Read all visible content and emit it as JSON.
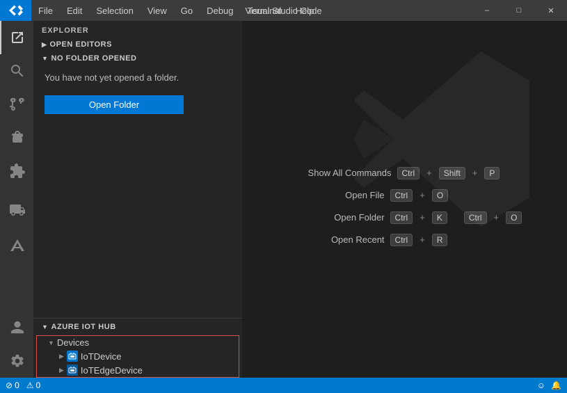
{
  "titleBar": {
    "title": "Visual Studio Code",
    "menu": [
      "File",
      "Edit",
      "Selection",
      "View",
      "Go",
      "Debug",
      "Terminal",
      "Help"
    ],
    "windowControls": [
      "minimize",
      "maximize",
      "close"
    ]
  },
  "activityBar": {
    "icons": [
      {
        "name": "explorer-icon",
        "symbol": "⬜",
        "active": true
      },
      {
        "name": "search-icon",
        "symbol": "🔍",
        "active": false
      },
      {
        "name": "source-control-icon",
        "symbol": "⑂",
        "active": false
      },
      {
        "name": "debug-icon",
        "symbol": "🐛",
        "active": false
      },
      {
        "name": "extensions-icon",
        "symbol": "⊞",
        "active": false
      },
      {
        "name": "remote-explorer-icon",
        "symbol": "🖥",
        "active": false
      },
      {
        "name": "azure-icon",
        "symbol": "▲",
        "active": false
      }
    ],
    "bottomIcons": [
      {
        "name": "accounts-icon",
        "symbol": "👤"
      },
      {
        "name": "settings-icon",
        "symbol": "⚙"
      }
    ]
  },
  "sidebar": {
    "header": "Explorer",
    "sections": [
      {
        "label": "Open Editors",
        "collapsed": true
      },
      {
        "label": "No Folder Opened",
        "collapsed": false
      }
    ],
    "noFolderText": "You have not yet opened a folder.",
    "openFolderLabel": "Open Folder",
    "azureSection": {
      "header": "Azure IoT Hub",
      "devices": {
        "label": "Devices",
        "children": [
          {
            "name": "IoTDevice",
            "icon": "device"
          },
          {
            "name": "IoTEdgeDevice",
            "icon": "edge-device"
          }
        ]
      }
    }
  },
  "welcome": {
    "shortcuts": [
      {
        "label": "Show All Commands",
        "keys": [
          {
            "key": "Ctrl",
            "sep": "+"
          },
          {
            "key": "Shift",
            "sep": "+"
          },
          {
            "key": "P"
          }
        ]
      },
      {
        "label": "Open File",
        "keys": [
          {
            "key": "Ctrl",
            "sep": "+"
          },
          {
            "key": "O"
          }
        ]
      },
      {
        "label": "Open Folder",
        "keys": [
          {
            "key": "Ctrl",
            "sep": "+"
          },
          {
            "key": "K",
            "sep": ""
          },
          {
            "key": "Ctrl",
            "sep": "+"
          },
          {
            "key": "O"
          }
        ]
      },
      {
        "label": "Open Recent",
        "keys": [
          {
            "key": "Ctrl",
            "sep": "+"
          },
          {
            "key": "R"
          }
        ]
      }
    ]
  },
  "statusBar": {
    "left": [
      {
        "text": "⓪ 0",
        "name": "errors-count"
      },
      {
        "text": "⚠ 0",
        "name": "warnings-count"
      }
    ],
    "right": [
      {
        "text": "😊",
        "name": "feedback-icon"
      },
      {
        "text": "🔔",
        "name": "notifications-icon"
      }
    ]
  }
}
